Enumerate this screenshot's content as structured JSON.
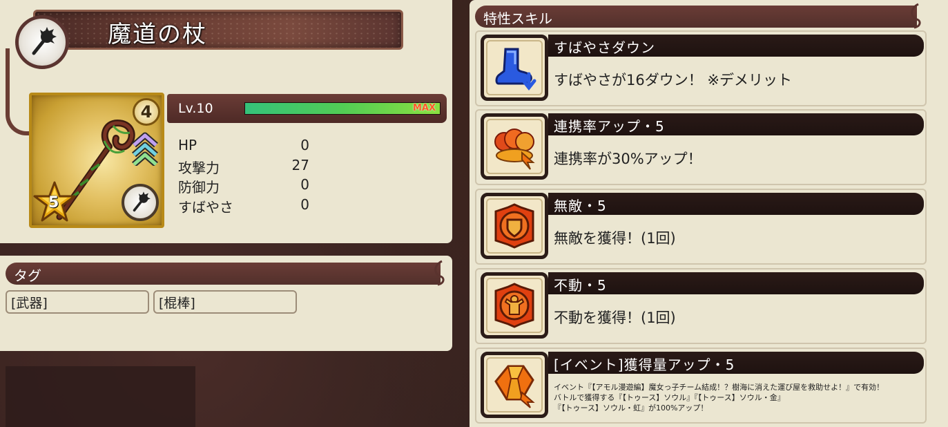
{
  "item": {
    "name": "魔道の杖",
    "rarity_badge": "4",
    "star_level": "5",
    "level_label": "Lv.10",
    "xp_fraction": 1.0,
    "max_label": "MAX",
    "stats": [
      {
        "label": "HP",
        "value": "0"
      },
      {
        "label": "攻撃力",
        "value": "27"
      },
      {
        "label": "防御力",
        "value": "0"
      },
      {
        "label": "すばやさ",
        "value": "0"
      }
    ]
  },
  "tags": {
    "title": "タグ",
    "items": [
      "[武器]",
      "[棍棒]"
    ]
  },
  "skills": {
    "title": "特性スキル",
    "items": [
      {
        "name": "すばやさダウン",
        "desc": "すばやさが16ダウン！ ※デメリット",
        "icon": "boot-down-icon"
      },
      {
        "name": "連携率アップ・5",
        "desc": "連携率が30%アップ！",
        "icon": "chain-up-icon"
      },
      {
        "name": "無敵・5",
        "desc": "無敵を獲得！(1回)",
        "icon": "invincible-shield-icon"
      },
      {
        "name": "不動・5",
        "desc": "不動を獲得！(1回)",
        "icon": "steadfast-icon"
      },
      {
        "name": "[イベント]獲得量アップ・5",
        "desc": "イベント『【アモル漫遊編】魔女っ子チーム結成！？樹海に消えた運び屋を救助せよ！』で有効！\nバトルで獲得する『【トゥース】ソウル』『【トゥース】ソウル・金』\n『【トゥース】ソウル・虹』が100%アップ！",
        "icon": "gem-up-icon"
      }
    ]
  },
  "colors": {
    "panel": "#ebe6d1",
    "header": "#5a332e",
    "skill_bar": "#231613",
    "xp_green": "#52cc55",
    "max_red": "#ff5a2a"
  }
}
